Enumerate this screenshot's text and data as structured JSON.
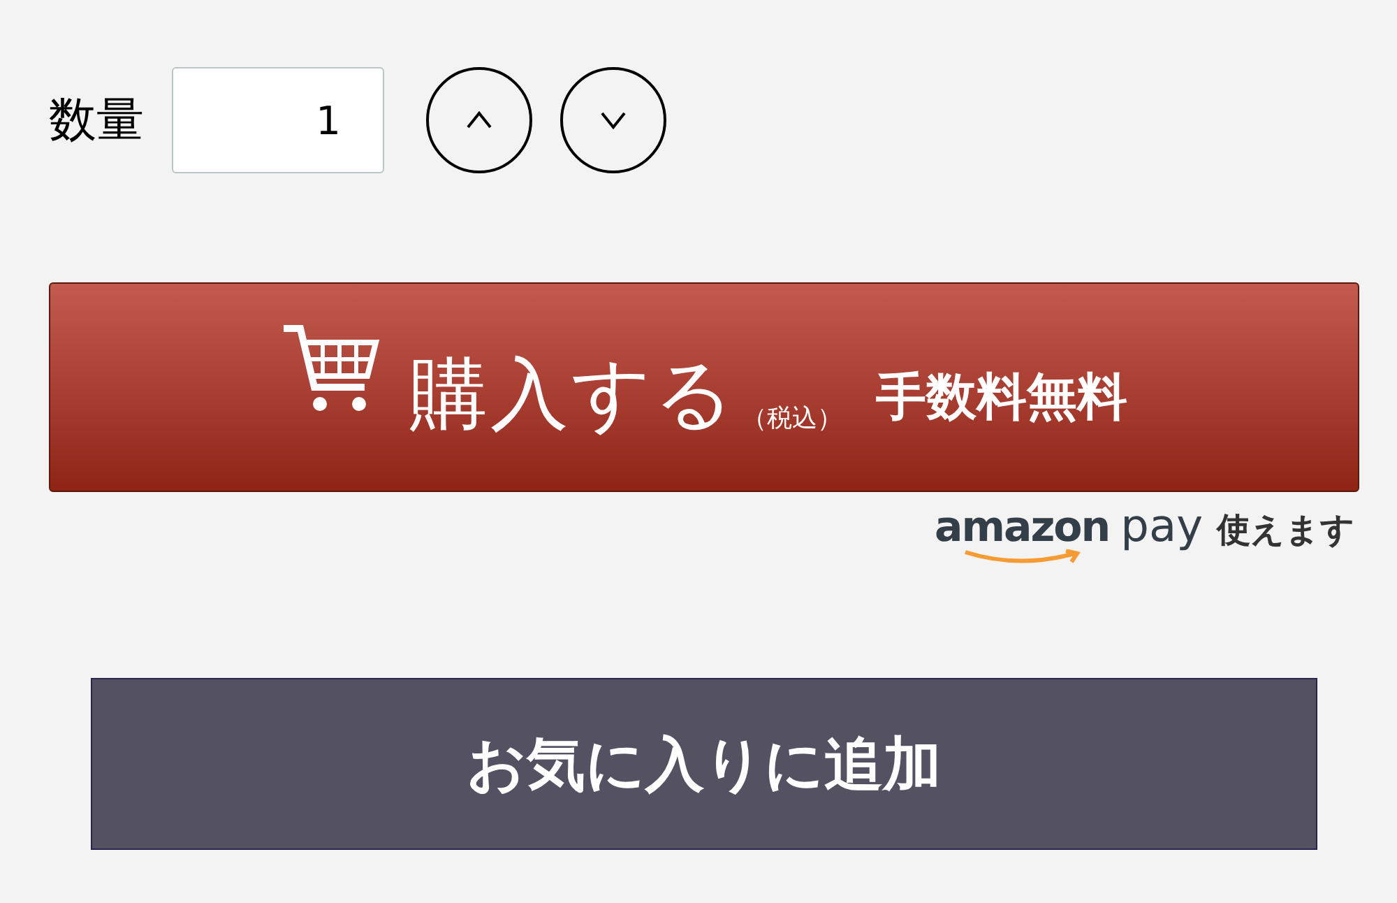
{
  "quantity": {
    "label": "数量",
    "value": "1"
  },
  "purchase_button": {
    "label": "購入する",
    "tax_note": "（税込）",
    "fee_note": "手数料無料"
  },
  "payment_note": {
    "brand_word_1": "amazon",
    "brand_word_2": "pay",
    "text": "使えます"
  },
  "favorite_button": {
    "label": "お気に入りに追加"
  }
}
